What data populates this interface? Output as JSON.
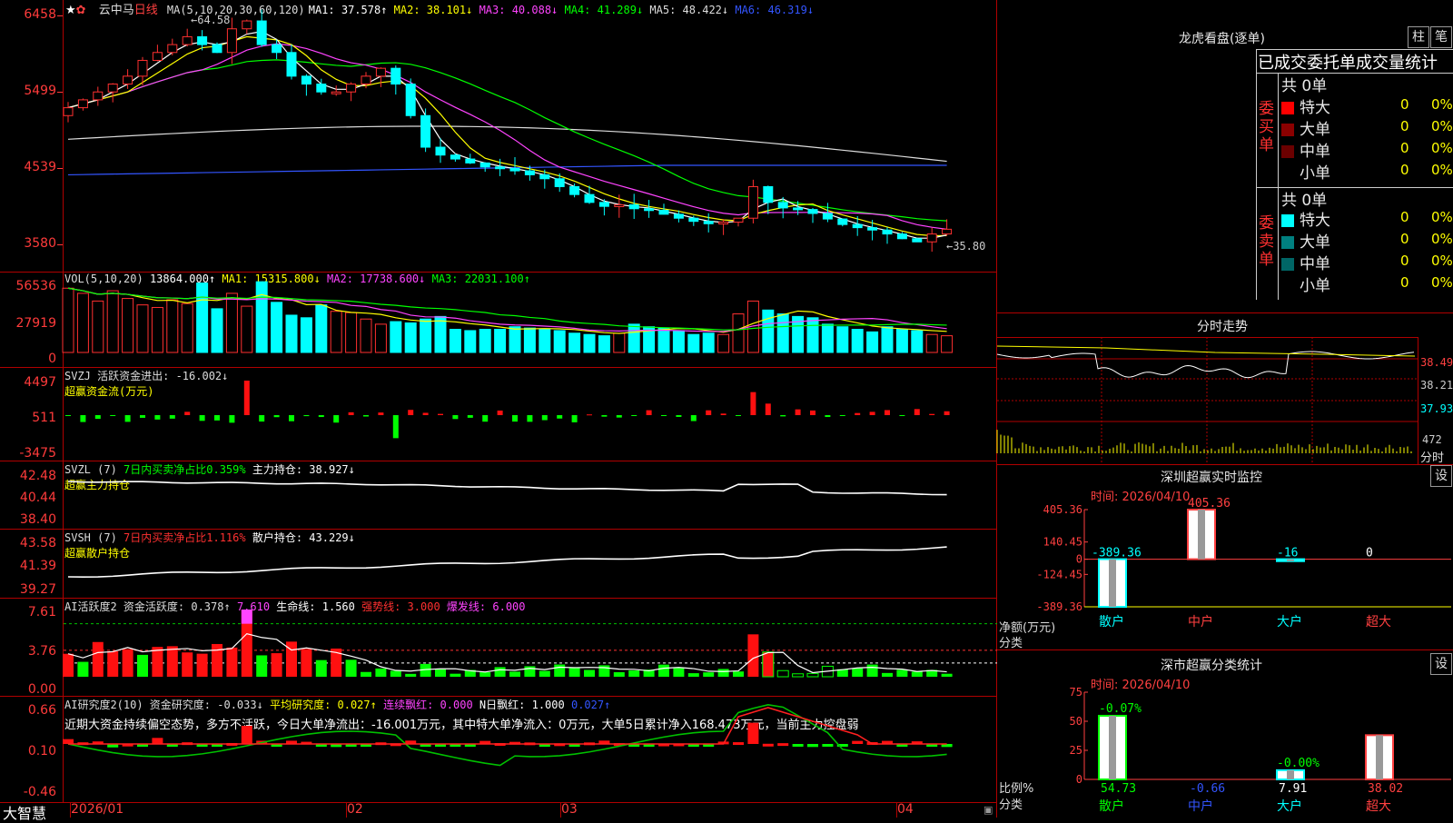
{
  "app": {
    "name": "大智慧"
  },
  "header": {
    "stock": "云中马",
    "period": "日线",
    "ma_label": "MA(5,10,20,30,60,120)",
    "ma_items": [
      {
        "text": "MA1: 37.578↑",
        "color": "#ffffff"
      },
      {
        "text": "MA2: 38.101↓",
        "color": "#ffff00"
      },
      {
        "text": "MA3: 40.088↓",
        "color": "#ff44ff"
      },
      {
        "text": "MA4: 41.289↓",
        "color": "#00ff00"
      },
      {
        "text": "MA5: 48.422↓",
        "color": "#dddddd"
      },
      {
        "text": "MA6: 46.319↓",
        "color": "#3355ff"
      }
    ]
  },
  "price_panel": {
    "yticks": [
      "6458",
      "5499",
      "4539",
      "3580"
    ],
    "high_label": "64.58",
    "low_label": "35.80"
  },
  "vol_panel": {
    "title": "VOL(5,10,20)",
    "value": "13864.000↑",
    "ma_items": [
      {
        "text": "MA1: 15315.800↓",
        "color": "#ffff00"
      },
      {
        "text": "MA2: 17738.600↓",
        "color": "#ff44ff"
      },
      {
        "text": "MA3: 22031.100↑",
        "color": "#00ff00"
      }
    ],
    "yticks": [
      "56536",
      "27919",
      "0"
    ]
  },
  "svzj_panel": {
    "title": "SVZJ  活跃资金进出: -16.002↓",
    "subtitle": "超赢资金流(万元)",
    "yticks": [
      "4497",
      "511",
      "-3475"
    ]
  },
  "svzl_panel": {
    "title": "SVZL (7)",
    "part2": "7日内买卖净占比0.359%",
    "part3": "主力持仓: 38.927↓",
    "subtitle": "超赢主力持仓",
    "yticks": [
      "42.48",
      "40.44",
      "38.40"
    ]
  },
  "svsh_panel": {
    "title": "SVSH (7)",
    "part2": "7日内买卖净占比1.116%",
    "part3": "散户持仓: 43.229↓",
    "subtitle": "超赢散户持仓",
    "yticks": [
      "43.58",
      "41.39",
      "39.27"
    ]
  },
  "ai_active_panel": {
    "title": "AI活跃度2 资金活跃度: 0.378↑",
    "v2": "7.610",
    "v3": "生命线: 1.560",
    "v4": "强势线: 3.000",
    "v5": "爆发线: 6.000",
    "yticks": [
      "7.61",
      "3.76",
      "0.00"
    ]
  },
  "ai_research_panel": {
    "title": "AI研究度2(10) 资金研究度: -0.033↓",
    "v2": "平均研究度: 0.027↑",
    "v3": "连续飘红: 0.000",
    "v4": "N日飘红: 1.000",
    "v5": "0.027↑",
    "comment": "近期大资金持续偏空态势，多方不活跃，今日大单净流出：-16.001万元，其中特大单净流入：0万元，大单5日累计净入168.473万元，当前主力控盘弱",
    "yticks": [
      "0.66",
      "0.10",
      "-0.46"
    ]
  },
  "xaxis": {
    "labels": [
      "2026/01",
      "02",
      "03",
      "04"
    ]
  },
  "right": {
    "lhb_title": "龙虎看盘(逐单)",
    "btn_zhu": "柱",
    "btn_bi": "笔",
    "stats_title": "已成交委托单成交量统计",
    "buy": {
      "side": "委买单",
      "total": "共 0单",
      "rows": [
        {
          "label": "特大",
          "count": "0",
          "pct": "0%",
          "color": "#ff0000"
        },
        {
          "label": "大单",
          "count": "0",
          "pct": "0%",
          "color": "#8b0000"
        },
        {
          "label": "中单",
          "count": "0",
          "pct": "0%",
          "color": "#6b0000"
        },
        {
          "label": "小单",
          "count": "0",
          "pct": "0%",
          "color": "#000000"
        }
      ]
    },
    "sell": {
      "side": "委卖单",
      "total": "共 0单",
      "rows": [
        {
          "label": "特大",
          "count": "0",
          "pct": "0%",
          "color": "#00ffff"
        },
        {
          "label": "大单",
          "count": "0",
          "pct": "0%",
          "color": "#008080"
        },
        {
          "label": "中单",
          "count": "0",
          "pct": "0%",
          "color": "#006666"
        },
        {
          "label": "小单",
          "count": "0",
          "pct": "0%",
          "color": "#000000"
        }
      ]
    },
    "intraday": {
      "title": "分时走势",
      "yticks": [
        "38.49",
        "38.21",
        "37.93"
      ],
      "vol_tick": "472",
      "vol_label": "分时"
    },
    "sz_monitor": {
      "title": "深圳超赢实时监控",
      "btn": "设",
      "time": "时间: 2026/04/10",
      "yticks": [
        "405.36",
        "140.45",
        "0",
        "-124.45",
        "-389.36"
      ],
      "ylabel": "净额(万元)",
      "xlabel": "分类",
      "bars": [
        {
          "name": "散户",
          "value": -389.36,
          "label": "-389.36"
        },
        {
          "name": "中户",
          "value": 405.36,
          "label": "405.36"
        },
        {
          "name": "大户",
          "value": -16,
          "label": "-16"
        },
        {
          "name": "超大",
          "value": 0,
          "label": "0"
        }
      ]
    },
    "sz_class": {
      "title": "深市超赢分类统计",
      "btn": "设",
      "time": "时间: 2026/04/10",
      "yticks": [
        "75",
        "50",
        "25",
        "0"
      ],
      "ylabel": "比例%",
      "xlabel": "分类",
      "bars": [
        {
          "name": "散户",
          "value": 54.73,
          "label": "54.73",
          "top_label": "-0.07%"
        },
        {
          "name": "中户",
          "value": 0,
          "label": "-0.66",
          "top_label": ""
        },
        {
          "name": "大户",
          "value": 7.91,
          "label": "7.91",
          "top_label": "-0.00%"
        },
        {
          "name": "超大",
          "value": 38.02,
          "label": "38.02",
          "top_label": ""
        }
      ]
    }
  },
  "chart_data": [
    {
      "type": "candlestick",
      "title": "云中马 日线",
      "ylim": [
        35.8,
        64.58
      ],
      "ylabel": "",
      "note_values": [
        "64.58",
        "35.80"
      ]
    },
    {
      "type": "bar",
      "title": "深圳超赢实时监控",
      "categories": [
        "散户",
        "中户",
        "大户",
        "超大"
      ],
      "values": [
        -389.36,
        405.36,
        -16,
        0
      ],
      "ylim": [
        -389.36,
        405.36
      ],
      "ylabel": "净额(万元)",
      "xlabel": "分类"
    },
    {
      "type": "bar",
      "title": "深市超赢分类统计",
      "categories": [
        "散户",
        "中户",
        "大户",
        "超大"
      ],
      "values": [
        54.73,
        -0.66,
        7.91,
        38.02
      ],
      "ylim": [
        0,
        75
      ],
      "ylabel": "比例%",
      "xlabel": "分类"
    }
  ]
}
